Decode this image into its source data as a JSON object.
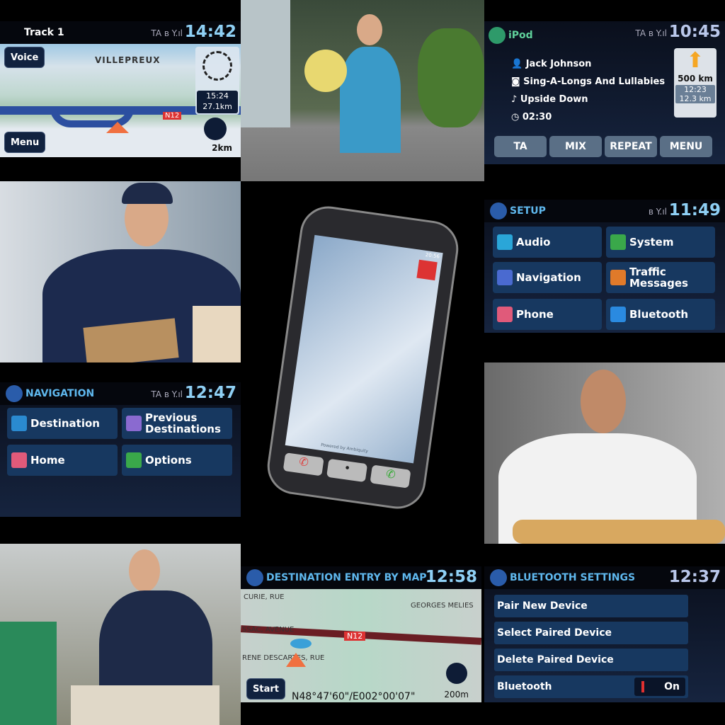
{
  "nav_map": {
    "track": "Track 1",
    "status": "TA ʙ Y.ıl",
    "time": "14:42",
    "voice": "Voice",
    "menu": "Menu",
    "city": "VILLEPREUX",
    "eta_time": "15:24",
    "eta_dist": "27.1km",
    "road": "N12",
    "scale": "2km"
  },
  "ipod": {
    "title": "iPod",
    "status": "TA ʙ Y.ıl",
    "time": "10:45",
    "artist": "Jack Johnson",
    "album": "Sing-A-Longs And Lullabies",
    "track": "Upside Down",
    "elapsed": "02:30",
    "turn_dist": "500 km",
    "eta_time": "12:23",
    "eta_dist": "12.3 km",
    "buttons": [
      "TA",
      "MIX",
      "REPEAT",
      "MENU"
    ]
  },
  "setup": {
    "title": "SETUP",
    "status": "ʙ Y.ıl",
    "time": "11:49",
    "items": [
      {
        "label": "Audio",
        "color": "#2aa6d8"
      },
      {
        "label": "System",
        "color": "#3aa84a"
      },
      {
        "label": "Navigation",
        "color": "#4a6ad0"
      },
      {
        "label": "Traffic Messages",
        "color": "#e07a2a"
      },
      {
        "label": "Phone",
        "color": "#e05a7a"
      },
      {
        "label": "Bluetooth",
        "color": "#2a8ae0"
      }
    ]
  },
  "navigation": {
    "title": "NAVIGATION",
    "status": "TA ʙ Y.ıl",
    "time": "12:47",
    "items": [
      {
        "label": "Destination",
        "color": "#2a8ad0"
      },
      {
        "label": "Previous Destinations",
        "color": "#8a6ad0"
      },
      {
        "label": "Home",
        "color": "#e05a7a"
      },
      {
        "label": "Options",
        "color": "#3aa84a"
      }
    ]
  },
  "dest_map": {
    "title": "DESTINATION ENTRY BY MAP",
    "time": "12:58",
    "streets": [
      "CURIE, RUE",
      "GEORGES MELIES",
      "SSAC, AVENUE",
      "RENE DESCARTES, RUE"
    ],
    "road": "N12",
    "start": "Start",
    "coords": "N48°47'60\"/E002°00'07\"",
    "scale": "200m"
  },
  "bluetooth": {
    "title": "BLUETOOTH SETTINGS",
    "time": "12:37",
    "items": [
      "Pair New Device",
      "Select Paired Device",
      "Delete Paired Device"
    ],
    "toggle_label": "Bluetooth",
    "toggle_value": "On"
  },
  "phone": {
    "time": "20:56",
    "footer": "Powered by Ambiquity"
  }
}
